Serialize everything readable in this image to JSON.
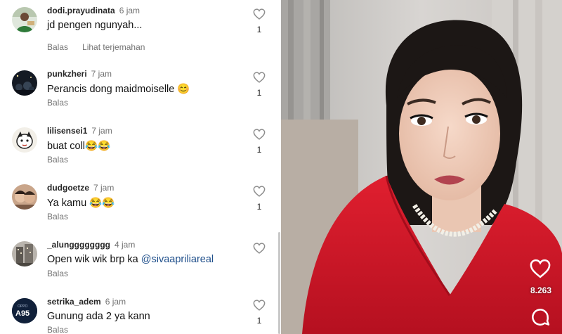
{
  "comments": [
    {
      "username": "dodi.prayudinata",
      "time": "6 jam",
      "text": "jd pengen ngunyah...",
      "mention": "",
      "reply_label": "Balas",
      "translate_label": "Lihat terjemahan",
      "likes": "1",
      "avatar": "person-green-shirt"
    },
    {
      "username": "punkzheri",
      "time": "7 jam",
      "text": "Perancis dong maidmoiselle 😊",
      "mention": "",
      "reply_label": "Balas",
      "translate_label": "",
      "likes": "1",
      "avatar": "night-crowd"
    },
    {
      "username": "lilisensei1",
      "time": "7 jam",
      "text": "buat coll😂😂",
      "mention": "",
      "reply_label": "Balas",
      "translate_label": "",
      "likes": "1",
      "avatar": "cartoon-face"
    },
    {
      "username": "dudgoetze",
      "time": "7 jam",
      "text": "Ya kamu 😂😂",
      "mention": "",
      "reply_label": "Balas",
      "translate_label": "",
      "likes": "1",
      "avatar": "two-people"
    },
    {
      "username": "_alungggggggg",
      "time": "4 jam",
      "text": "Open wik wik brp ka ",
      "mention": "@sivaapriliareal",
      "reply_label": "Balas",
      "translate_label": "",
      "likes": "",
      "avatar": "building"
    },
    {
      "username": "setrika_adem",
      "time": "6 jam",
      "text": "Gunung ada 2 ya kann",
      "mention": "",
      "reply_label": "Balas",
      "translate_label": "",
      "likes": "1",
      "avatar": "phone-a95",
      "avatar_text_top": "OPPO",
      "avatar_text": "A95"
    }
  ],
  "video": {
    "like_count": "8.263",
    "like_icon": "heart-outline-icon",
    "comment_icon": "comment-bubble-icon"
  },
  "colors": {
    "dress": "#d7192a",
    "mention": "#1f4f8b",
    "muted_text": "#737373"
  }
}
